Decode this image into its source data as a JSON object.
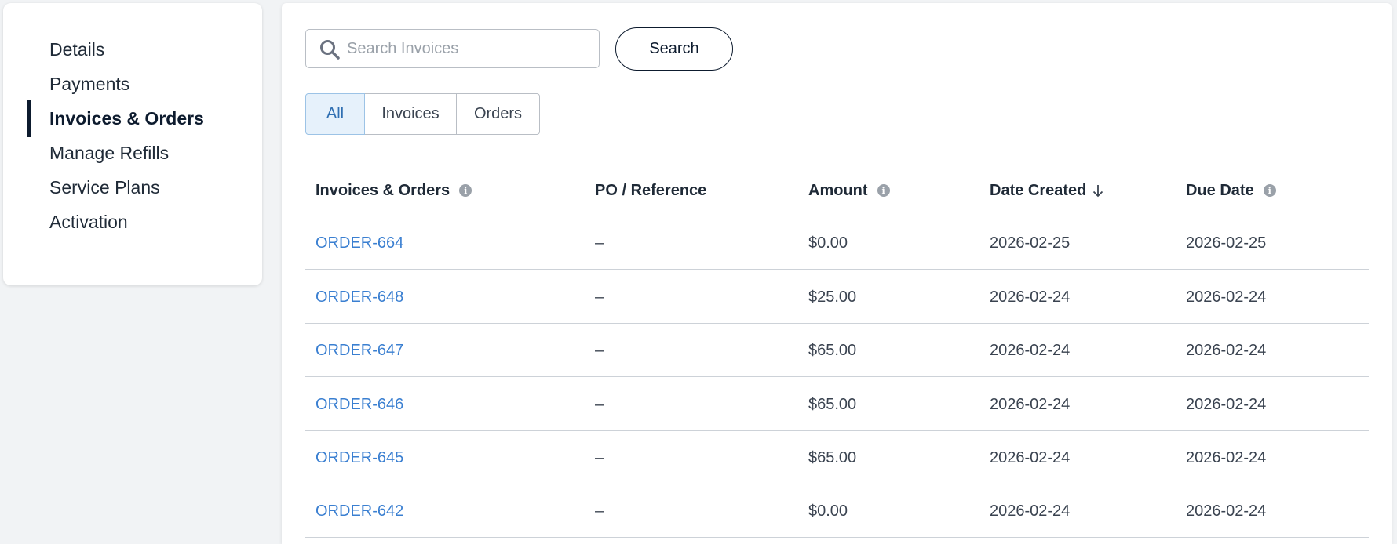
{
  "sidebar": {
    "items": [
      {
        "label": "Details",
        "active": false
      },
      {
        "label": "Payments",
        "active": false
      },
      {
        "label": "Invoices & Orders",
        "active": true
      },
      {
        "label": "Manage Refills",
        "active": false
      },
      {
        "label": "Service Plans",
        "active": false
      },
      {
        "label": "Activation",
        "active": false
      }
    ]
  },
  "search": {
    "placeholder": "Search Invoices",
    "value": "",
    "button_label": "Search",
    "icon": "search-icon"
  },
  "filter_tabs": [
    {
      "label": "All",
      "active": true
    },
    {
      "label": "Invoices",
      "active": false
    },
    {
      "label": "Orders",
      "active": false
    }
  ],
  "table": {
    "columns": [
      {
        "label": "Invoices & Orders",
        "icon": "info-icon"
      },
      {
        "label": "PO / Reference"
      },
      {
        "label": "Amount",
        "icon": "info-icon"
      },
      {
        "label": "Date Created",
        "icon": "sort-descending-icon"
      },
      {
        "label": "Due Date",
        "icon": "info-icon"
      }
    ],
    "rows": [
      {
        "id": "ORDER-664",
        "reference": "–",
        "amount": "$0.00",
        "created": "2026-02-25",
        "due": "2026-02-25"
      },
      {
        "id": "ORDER-648",
        "reference": "–",
        "amount": "$25.00",
        "created": "2026-02-24",
        "due": "2026-02-24"
      },
      {
        "id": "ORDER-647",
        "reference": "–",
        "amount": "$65.00",
        "created": "2026-02-24",
        "due": "2026-02-24"
      },
      {
        "id": "ORDER-646",
        "reference": "–",
        "amount": "$65.00",
        "created": "2026-02-24",
        "due": "2026-02-24"
      },
      {
        "id": "ORDER-645",
        "reference": "–",
        "amount": "$65.00",
        "created": "2026-02-24",
        "due": "2026-02-24"
      },
      {
        "id": "ORDER-642",
        "reference": "–",
        "amount": "$0.00",
        "created": "2026-02-24",
        "due": "2026-02-24"
      }
    ]
  },
  "colors": {
    "accent_dark": "#0d1b2e",
    "link": "#3a7fd1",
    "tab_active_bg": "#e6f1fb",
    "page_bg": "#f1f3f5"
  }
}
